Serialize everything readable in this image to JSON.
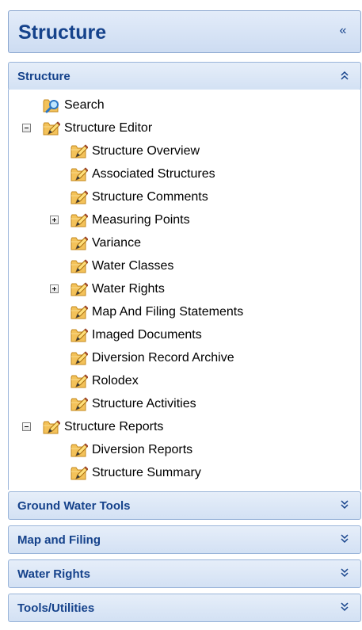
{
  "header": {
    "title": "Structure",
    "collapse_glyph": "«"
  },
  "sections": {
    "structure": {
      "title": "Structure",
      "state": "expanded"
    },
    "ground_water_tools": {
      "title": "Ground Water Tools",
      "state": "collapsed"
    },
    "map_and_filing": {
      "title": "Map and Filing",
      "state": "collapsed"
    },
    "water_rights": {
      "title": "Water Rights",
      "state": "collapsed"
    },
    "tools_utilities": {
      "title": "Tools/Utilities",
      "state": "collapsed"
    }
  },
  "tree": {
    "search": {
      "label": "Search",
      "icon": "search-folder-icon"
    },
    "structure_editor": {
      "label": "Structure Editor",
      "icon": "folder-edit-icon",
      "expanded": true,
      "children": [
        {
          "label": "Structure Overview"
        },
        {
          "label": "Associated Structures"
        },
        {
          "label": "Structure Comments"
        },
        {
          "label": "Measuring Points",
          "expandable": true
        },
        {
          "label": "Variance"
        },
        {
          "label": "Water Classes"
        },
        {
          "label": "Water Rights",
          "expandable": true
        },
        {
          "label": "Map And Filing Statements"
        },
        {
          "label": "Imaged Documents"
        },
        {
          "label": "Diversion Record Archive"
        },
        {
          "label": "Rolodex"
        },
        {
          "label": "Structure Activities"
        }
      ]
    },
    "structure_reports": {
      "label": "Structure Reports",
      "icon": "folder-edit-icon",
      "expanded": true,
      "children": [
        {
          "label": "Diversion Reports"
        },
        {
          "label": "Structure Summary"
        }
      ]
    }
  },
  "colors": {
    "header_text": "#15428b",
    "border": "#99b4d9",
    "folder": "#f5c85b",
    "pencil": "#e9a63a"
  }
}
